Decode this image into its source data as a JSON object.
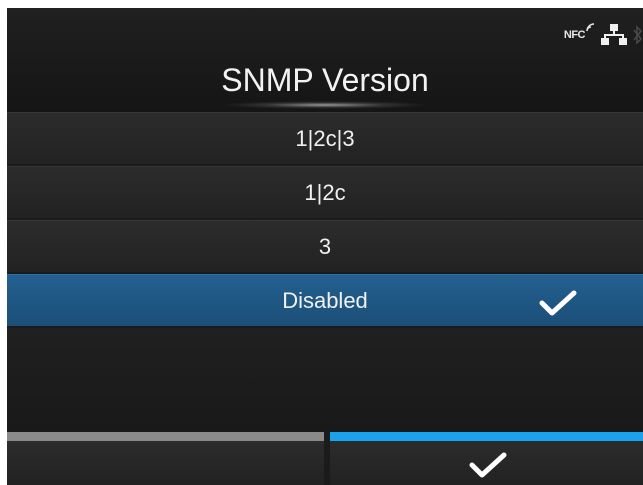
{
  "status": {
    "nfc_label": "NFC",
    "icons": [
      "nfc-icon",
      "wired-lan-icon",
      "bluetooth-icon"
    ]
  },
  "header": {
    "title": "SNMP Version"
  },
  "options": [
    {
      "label": "1|2c|3",
      "selected": false
    },
    {
      "label": "1|2c",
      "selected": false
    },
    {
      "label": "3",
      "selected": false
    },
    {
      "label": "Disabled",
      "selected": true
    }
  ],
  "footer": {
    "left_button": "back",
    "right_button": "confirm-check-icon"
  },
  "colors": {
    "selected_row": "#1f5a86",
    "confirm_bar": "#1aa3ec",
    "back_bar": "#8a8a8a"
  }
}
